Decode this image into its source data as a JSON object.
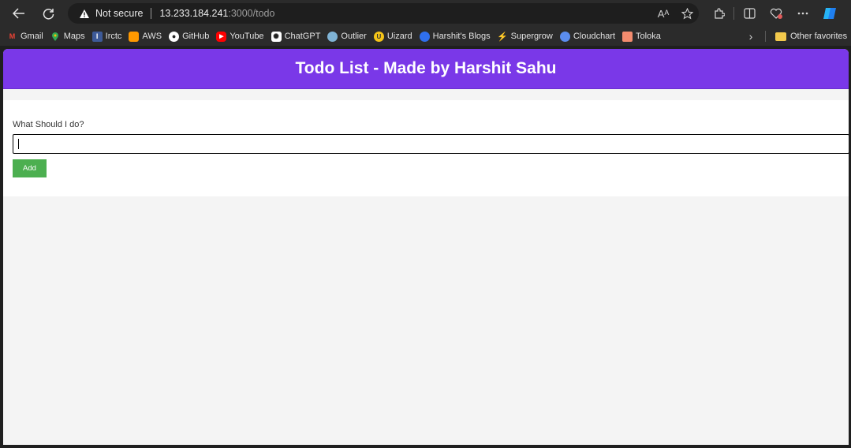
{
  "browser": {
    "security_label": "Not secure",
    "url_host": "13.233.184.241",
    "url_path": ":3000/todo",
    "read_aloud_glyph": "Aᴬ",
    "icons": [
      "back-arrow-icon",
      "reload-icon",
      "warning-icon",
      "read-aloud-icon",
      "favorite-star-icon",
      "extensions-icon",
      "split-screen-icon",
      "health-heart-icon",
      "more-menu-icon",
      "copilot-icon"
    ]
  },
  "bookmarks": {
    "items": [
      {
        "label": "Gmail",
        "icon": "gmail-icon",
        "color": "#ea4335"
      },
      {
        "label": "Maps",
        "icon": "maps-pin-icon",
        "color": "#34a853"
      },
      {
        "label": "Irctc",
        "icon": "irctc-icon",
        "color": "#3d5a98"
      },
      {
        "label": "AWS",
        "icon": "aws-cube-icon",
        "color": "#ff9900"
      },
      {
        "label": "GitHub",
        "icon": "github-icon",
        "color": "#ffffff"
      },
      {
        "label": "YouTube",
        "icon": "youtube-icon",
        "color": "#ff0000"
      },
      {
        "label": "ChatGPT",
        "icon": "chatgpt-icon",
        "color": "#ffffff"
      },
      {
        "label": "Outlier",
        "icon": "outlier-icon",
        "color": "#7fb3d5"
      },
      {
        "label": "Uizard",
        "icon": "uizard-icon",
        "color": "#f5c518"
      },
      {
        "label": "Harshit's Blogs",
        "icon": "blog-icon",
        "color": "#2f6fed"
      },
      {
        "label": "Supergrow",
        "icon": "supergrow-icon",
        "color": "#3b82f6"
      },
      {
        "label": "Cloudchart",
        "icon": "cloudchart-icon",
        "color": "#5b8def"
      },
      {
        "label": "Toloka",
        "icon": "toloka-icon",
        "color": "#f28b6e"
      }
    ],
    "other_label": "Other favorites"
  },
  "app": {
    "title": "Todo List - Made by Harshit Sahu",
    "header_color": "#7a38e8",
    "form_label": "What Should I do?",
    "input_value": "",
    "add_button_label": "Add",
    "add_button_color": "#4caf50"
  }
}
